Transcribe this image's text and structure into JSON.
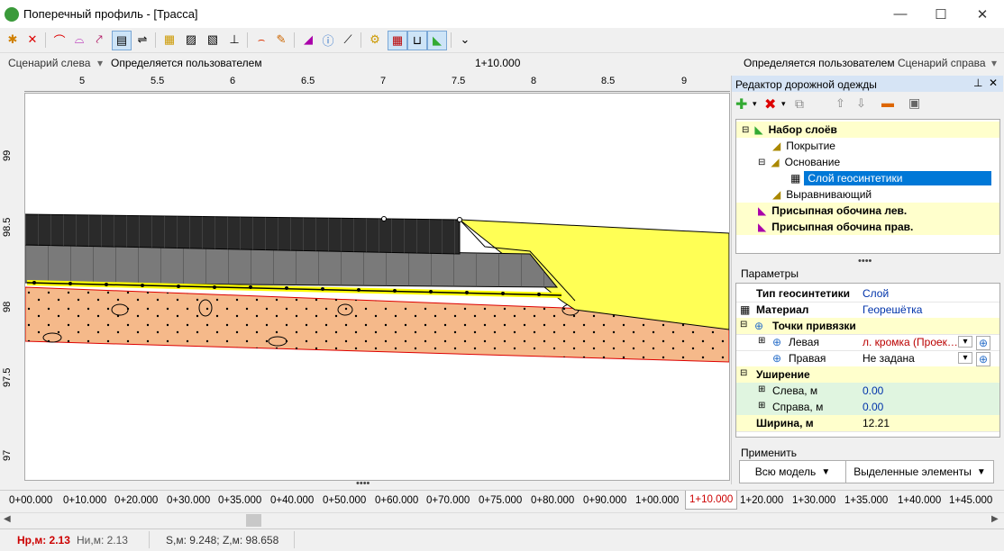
{
  "window": {
    "title": "Поперечный профиль - [Трасса]",
    "minimize": "—",
    "maximize": "☐",
    "close": "✕"
  },
  "toolbar": {
    "icons": [
      "add-vertex-icon",
      "delete-vertex-icon",
      "arc-icon",
      "dashed-arc-icon",
      "pick-icon",
      "layers-icon",
      "align-icon",
      "folder-icon",
      "hatch-icon",
      "hatch2-icon",
      "anchor-icon",
      "curve-icon",
      "brush-icon",
      "slope-icon",
      "info-icon",
      "measure-icon",
      "settings-icon",
      "table-icon",
      "scale-icon",
      "pavement-icon",
      "more-icon"
    ]
  },
  "scenario": {
    "left_label": "Сценарий слева",
    "left_value": "Определяется пользователем",
    "center_station": "1+10.000",
    "right_value": "Определяется пользователем",
    "right_label": "Сценарий справа"
  },
  "ruler": {
    "ticks": [
      "5",
      "5.5",
      "6",
      "6.5",
      "7",
      "7.5",
      "8",
      "8.5",
      "9"
    ]
  },
  "vruler": {
    "ticks": [
      "99",
      "98.5",
      "98",
      "97.5",
      "97"
    ]
  },
  "colors": {
    "accent": "#0078d7",
    "layer_top": "#2a2a2a",
    "layer_base": "#7a7a7a",
    "soil": "#f5b98a",
    "shoulder": "#ffff55",
    "geosynthetic": "#ffff00"
  },
  "panel": {
    "title": "Редактор дорожной одежды",
    "tree": [
      {
        "label": "Набор слоёв",
        "group": true
      },
      {
        "label": "Покрытие",
        "group": false
      },
      {
        "label": "Основание",
        "group": false
      },
      {
        "label": "Слой геосинтетики",
        "group": false
      },
      {
        "label": "Выравнивающий",
        "group": false
      },
      {
        "label": "Присыпная обочина лев.",
        "group": true
      },
      {
        "label": "Присыпная обочина прав.",
        "group": true
      }
    ],
    "params_title": "Параметры",
    "params": [
      {
        "key": "Тип геосинтетики",
        "value": "Слой"
      },
      {
        "key": "Материал",
        "value": "Георешётка"
      },
      {
        "key": "Точки привязки",
        "value": ""
      },
      {
        "key": "Левая",
        "value": "л. кромка (Проек…"
      },
      {
        "key": "Правая",
        "value": "Не задана"
      },
      {
        "key": "Уширение",
        "value": ""
      },
      {
        "key": "Слева, м",
        "value": "0.00"
      },
      {
        "key": "Справа, м",
        "value": "0.00"
      },
      {
        "key": "Ширина, м",
        "value": "12.21"
      }
    ],
    "apply_label": "Применить",
    "btn_all": "Всю модель",
    "btn_selected": "Выделенные элементы"
  },
  "stations": [
    "0+00.000",
    "0+10.000",
    "0+20.000",
    "0+30.000",
    "0+35.000",
    "0+40.000",
    "0+50.000",
    "0+60.000",
    "0+70.000",
    "0+75.000",
    "0+80.000",
    "0+90.000",
    "1+00.000",
    "1+10.000",
    "1+20.000",
    "1+30.000",
    "1+35.000",
    "1+40.000",
    "1+45.000"
  ],
  "active_station": "1+10.000",
  "status": {
    "hr": "Hр,м: 2.13",
    "hi": "Hи,м: 2.13",
    "coords": "S,м: 9.248;  Z,м: 98.658"
  }
}
